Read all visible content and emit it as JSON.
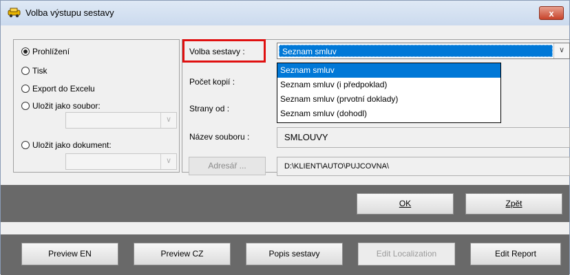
{
  "window": {
    "title": "Volba výstupu sestavy",
    "close_label": "x"
  },
  "output": {
    "options": [
      {
        "label": "Prohlížení",
        "selected": true
      },
      {
        "label": "Tisk",
        "selected": false
      },
      {
        "label": "Export do Excelu",
        "selected": false
      },
      {
        "label": "Uložit jako soubor:",
        "selected": false
      },
      {
        "label": "Uložit jako dokument:",
        "selected": false
      }
    ]
  },
  "form": {
    "report_label": "Volba sestavy :",
    "report_value": "Seznam smluv",
    "report_options": [
      "Seznam smluv",
      "Seznam smluv (i předpoklad)",
      "Seznam smluv (prvotní doklady)",
      "Seznam smluv (dohodl)"
    ],
    "copies_label": "Počet kopií :",
    "pages_label": "Strany od :",
    "filename_label": "Název souboru :",
    "filename_value": "SMLOUVY",
    "folder_button": "Adresář ...",
    "folder_value": "D:\\KLIENT\\AUTO\\PUJCOVNA\\"
  },
  "actions": {
    "ok_label": "OK",
    "back_label": "Zpět"
  },
  "bottom": {
    "preview_en": "Preview EN",
    "preview_cz": "Preview CZ",
    "popis": "Popis sestavy",
    "edit_localization": "Edit Localization",
    "edit_report": "Edit Report"
  },
  "colors": {
    "selection": "#0078d7",
    "highlight_box": "#e01010",
    "strip": "#696969"
  }
}
